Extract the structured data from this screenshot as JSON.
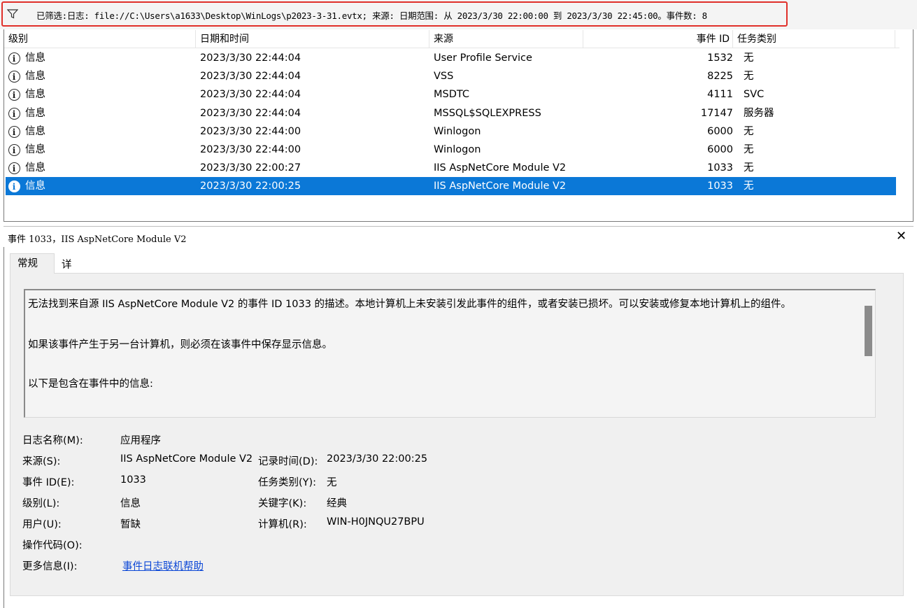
{
  "filter": {
    "text": "已筛选:日志: file://C:\\Users\\a1633\\Desktop\\WinLogs\\p2023-3-31.evtx; 来源: 日期范围: 从 2023/3/30 22:00:00 到 2023/3/30 22:45:00。事件数: 8",
    "icon": "filter-icon"
  },
  "columns": [
    "级别",
    "日期和时间",
    "来源",
    "事件 ID",
    "任务类别"
  ],
  "events": [
    {
      "level": "信息",
      "date": "2023/3/30 22:44:04",
      "source": "User Profile Service",
      "id": "1532",
      "task": "无"
    },
    {
      "level": "信息",
      "date": "2023/3/30 22:44:04",
      "source": "VSS",
      "id": "8225",
      "task": "无"
    },
    {
      "level": "信息",
      "date": "2023/3/30 22:44:04",
      "source": "MSDTC",
      "id": "4111",
      "task": "SVC"
    },
    {
      "level": "信息",
      "date": "2023/3/30 22:44:04",
      "source": "MSSQL$SQLEXPRESS",
      "id": "17147",
      "task": "服务器"
    },
    {
      "level": "信息",
      "date": "2023/3/30 22:44:00",
      "source": "Winlogon",
      "id": "6000",
      "task": "无"
    },
    {
      "level": "信息",
      "date": "2023/3/30 22:44:00",
      "source": "Winlogon",
      "id": "6000",
      "task": "无"
    },
    {
      "level": "信息",
      "date": "2023/3/30 22:00:27",
      "source": "IIS AspNetCore Module V2",
      "id": "1033",
      "task": "无"
    },
    {
      "level": "信息",
      "date": "2023/3/30 22:00:25",
      "source": "IIS AspNetCore Module V2",
      "id": "1033",
      "task": "无"
    }
  ],
  "selected_row": 8,
  "detail": {
    "title": "事件 1033，IIS AspNetCore Module V2",
    "tabs": [
      "常规",
      "详细信息"
    ],
    "description": [
      "无法找到来自源 IIS AspNetCore Module V2 的事件 ID 1033 的描述。本地计算机上未安装引发此事件的组件，或者安装已损坏。可以安装或修复本地计算机上的组件。",
      "如果该事件产生于另一台计算机，则必须在该事件中保存显示信息。",
      "以下是包含在事件中的信息:"
    ],
    "props": {
      "log_name_label": "日志名称(M):",
      "log_name": "应用程序",
      "source_label": "来源(S):",
      "source": "IIS AspNetCore Module V2",
      "logged_label": "记录时间(D):",
      "logged": "2023/3/30 22:00:25",
      "event_id_label": "事件 ID(E):",
      "event_id": "1033",
      "task_label": "任务类别(Y):",
      "task": "无",
      "level_label": "级别(L):",
      "level": "信息",
      "keywords_label": "关键字(K):",
      "keywords": "经典",
      "user_label": "用户(U):",
      "user": "暂缺",
      "computer_label": "计算机(R):",
      "computer": "WIN-H0JNQU27BPU",
      "opcode_label": "操作代码(O):",
      "more_info_label": "更多信息(I):",
      "more_info_link": "事件日志联机帮助"
    }
  },
  "colors": {
    "selection": "#0b78d7",
    "highlight_border": "#e0302a",
    "link": "#0a46d6"
  }
}
